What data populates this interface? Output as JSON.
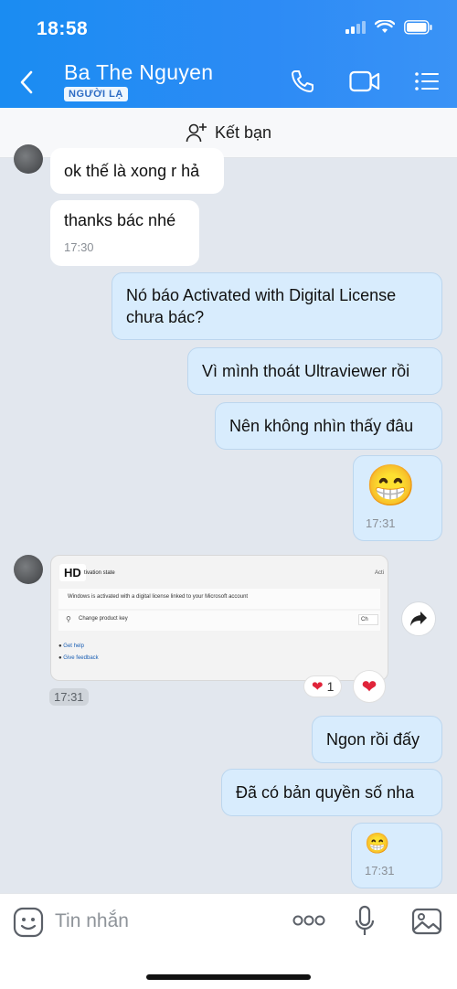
{
  "status": {
    "time": "18:58"
  },
  "header": {
    "contact_name": "Ba The Nguyen",
    "badge": "NGƯỜI LẠ"
  },
  "friend_bar": {
    "label": "Kết bạn"
  },
  "messages": {
    "m1": {
      "text": "ok thế là xong r hả"
    },
    "m2": {
      "text": "thanks bác nhé",
      "time": "17:30"
    },
    "m3": {
      "text": "Nó báo Activated with Digital License chưa bác?"
    },
    "m4": {
      "text": "Vì mình thoát Ultraviewer rồi"
    },
    "m5": {
      "text": "Nên không nhìn thấy đâu"
    },
    "m6": {
      "emoji": "😁",
      "time": "17:31"
    },
    "image": {
      "hd": "HD",
      "title_fragment": "tivation state",
      "right_fragment": "Acti",
      "line1": "Windows is activated with a digital license linked to your Microsoft account",
      "line2": "Change product key",
      "line2_right": "Ch",
      "link1": "Get help",
      "link2": "Give feedback",
      "time": "17:31",
      "reaction_count": "1"
    },
    "m7": {
      "text": "Ngon rồi đấy"
    },
    "m8": {
      "text": "Đã có bản quyền số nha"
    },
    "m9": {
      "emoji": "😁",
      "time": "17:31"
    }
  },
  "input": {
    "placeholder": "Tin nhắn"
  },
  "colors": {
    "header_blue": "#2d8bf5",
    "outgoing_bubble": "#d8ecfd",
    "incoming_bubble": "#ffffff",
    "background": "#e2e7ee"
  }
}
